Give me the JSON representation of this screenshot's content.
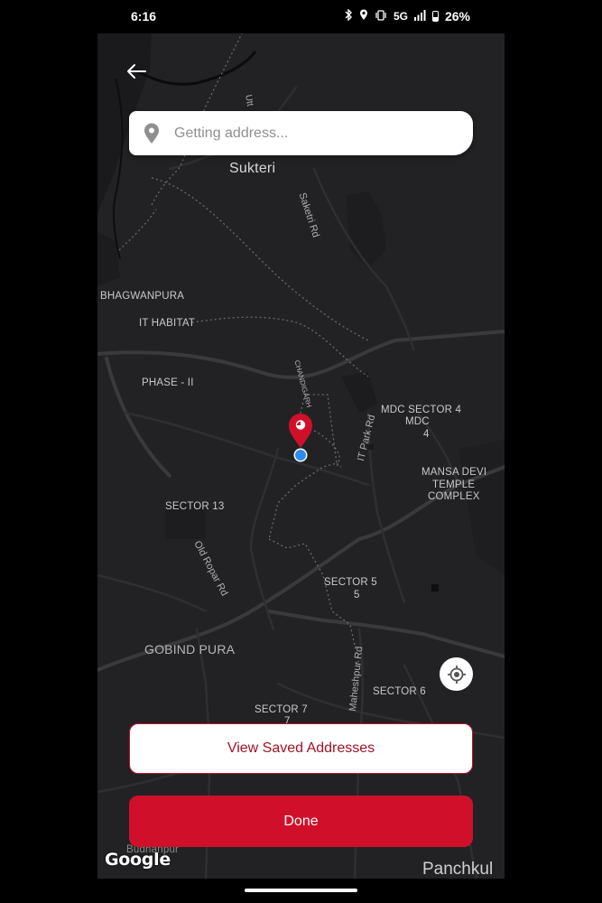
{
  "status_bar": {
    "time": "6:16",
    "signal_text": "5G",
    "battery": "26%"
  },
  "search": {
    "placeholder": "Getting address..."
  },
  "map": {
    "labels": {
      "sukteri": "Sukteri",
      "bhagwanpura": "BHAGWANPURA",
      "it_habitat": "IT HABITAT",
      "phase_ii": "PHASE - II",
      "mdc_sector_4": "MDC SECTOR 4",
      "mdc": "MDC",
      "mdc_num": "4",
      "mansa_devi_1": "MANSA DEVI",
      "mansa_devi_2": "TEMPLE",
      "mansa_devi_3": "COMPLEX",
      "sector_13": "SECTOR 13",
      "sector_5": "SECTOR 5",
      "sector_5_num": "5",
      "gobind_pura": "GOBIND PURA",
      "sector_6": "SECTOR 6",
      "sector_7": "SECTOR 7",
      "sector_7_num": "7",
      "panchkula": "Panchkul",
      "budhanpur": "Budhanpur"
    },
    "roads": {
      "sketri_rd": "Saketri Rd",
      "it_park_rd": "IT Park Rd",
      "old_ropar_rd": "Old Ropar Rd",
      "maheshpur_rd": "Maheshpur Rd",
      "chandigarh": "CHANDIGARH",
      "utt": "Utt"
    },
    "attribution": "Google"
  },
  "buttons": {
    "saved": "View Saved Addresses",
    "done": "Done"
  },
  "colors": {
    "accent": "#d0102a",
    "map_bg": "#222224",
    "location_dot": "#2f8ae8"
  }
}
